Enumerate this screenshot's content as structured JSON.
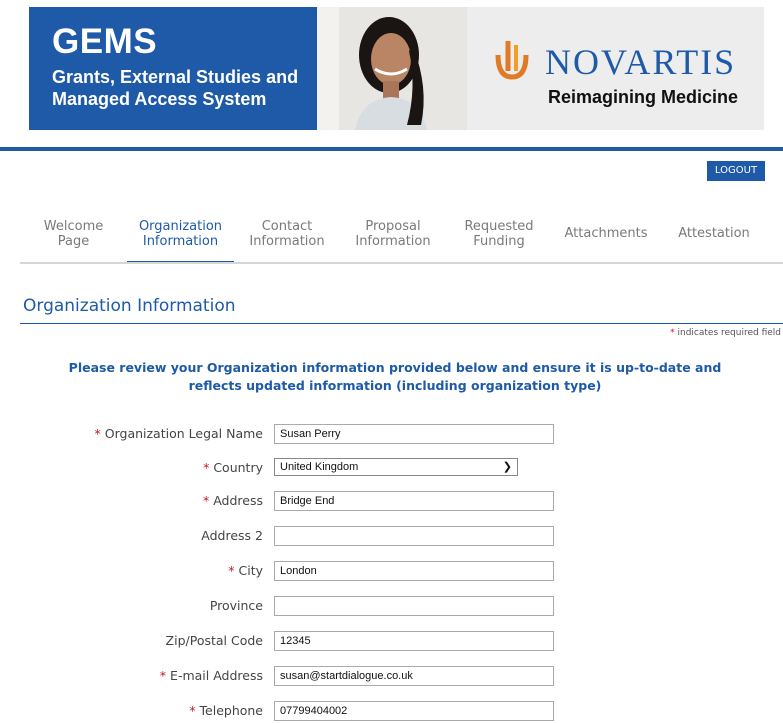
{
  "banner": {
    "gems_title": "GEMS",
    "gems_subtitle": "Grants, External Studies and Managed Access System",
    "brand_name": "NOVARTIS",
    "tagline": "Reimagining Medicine",
    "brand_color": "#1e5aa8"
  },
  "header": {
    "logout_label": "LOGOUT"
  },
  "tabs": [
    {
      "label": "Welcome\nPage",
      "active": false
    },
    {
      "label": "Organization\nInformation",
      "active": true
    },
    {
      "label": "Contact\nInformation",
      "active": false
    },
    {
      "label": "Proposal\nInformation",
      "active": false
    },
    {
      "label": "Requested\nFunding",
      "active": false
    },
    {
      "label": "Attachments",
      "active": false
    },
    {
      "label": "Attestation",
      "active": false
    }
  ],
  "section": {
    "title": "Organization Information",
    "required_star": "*",
    "required_note": "indicates required field",
    "notice": "Please review your Organization information provided below and ensure it is up-to-date and reflects updated information (including organization type)"
  },
  "form": {
    "org_legal_name": {
      "label": "Organization Legal Name",
      "value": "Susan Perry",
      "required": true
    },
    "country": {
      "label": "Country",
      "value": "United Kingdom",
      "required": true
    },
    "address": {
      "label": "Address",
      "value": "Bridge End",
      "required": true
    },
    "address2": {
      "label": "Address 2",
      "value": "",
      "required": false
    },
    "city": {
      "label": "City",
      "value": "London",
      "required": true
    },
    "province": {
      "label": "Province",
      "value": "",
      "required": false
    },
    "zip": {
      "label": "Zip/Postal Code",
      "value": "12345",
      "required": false
    },
    "email": {
      "label": "E-mail Address",
      "value": "susan@startdialogue.co.uk",
      "required": true
    },
    "telephone": {
      "label": "Telephone",
      "value": "07799404002",
      "required": true
    }
  }
}
